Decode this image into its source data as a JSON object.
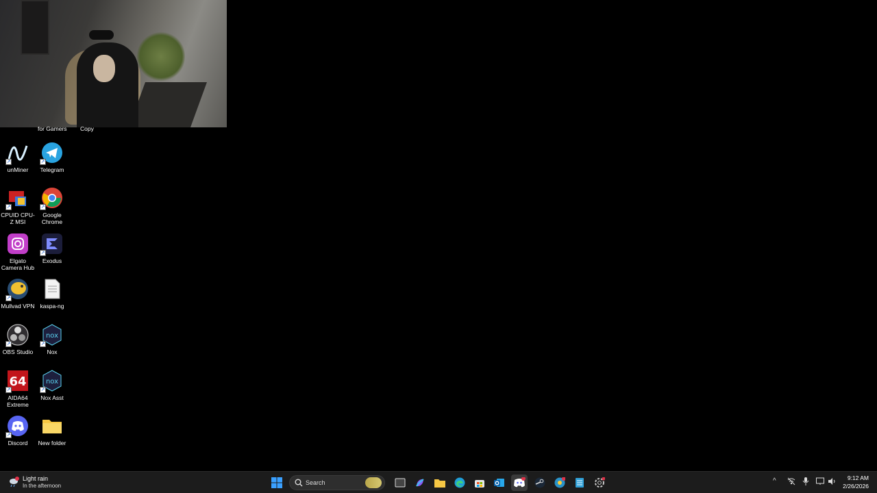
{
  "desktop": {
    "partial_labels": [
      "for Gamers",
      "Copy"
    ],
    "icons": [
      {
        "label": "unMiner",
        "icon": "unminer-icon"
      },
      {
        "label": "Telegram",
        "icon": "telegram-icon"
      },
      {
        "label": "CPUID CPU-Z MSI",
        "icon": "cpuz-icon"
      },
      {
        "label": "Google Chrome",
        "icon": "chrome-icon"
      },
      {
        "label": "Elgato Camera Hub",
        "icon": "elgato-camera-hub-icon"
      },
      {
        "label": "Exodus",
        "icon": "exodus-icon"
      },
      {
        "label": "Mullvad VPN",
        "icon": "mullvad-vpn-icon"
      },
      {
        "label": "kaspa-ng",
        "icon": "document-icon"
      },
      {
        "label": "OBS Studio",
        "icon": "obs-icon"
      },
      {
        "label": "Nox",
        "icon": "nox-icon"
      },
      {
        "label": "AIDA64 Extreme",
        "icon": "aida64-icon"
      },
      {
        "label": "Nox Asst",
        "icon": "nox-asst-icon"
      },
      {
        "label": "Discord",
        "icon": "discord-icon"
      },
      {
        "label": "New folder",
        "icon": "folder-icon"
      }
    ]
  },
  "taskbar": {
    "weather": {
      "title": "Light rain",
      "subtitle": "In the afternoon",
      "badge": "1"
    },
    "search_placeholder": "Search",
    "apps": [
      "start-icon",
      "task-view-icon",
      "copilot-icon",
      "file-explorer-icon",
      "edge-icon",
      "store-icon",
      "outlook-icon",
      "discord-icon",
      "steam-icon",
      "chrome-canary-icon",
      "notepad-icon",
      "settings-icon"
    ],
    "tray": {
      "time": "9:12 AM",
      "date": "2/26/2026"
    }
  },
  "colors": {
    "taskbar": "#1c1c1c",
    "desktop": "#000000",
    "accent": "#0078d4"
  }
}
